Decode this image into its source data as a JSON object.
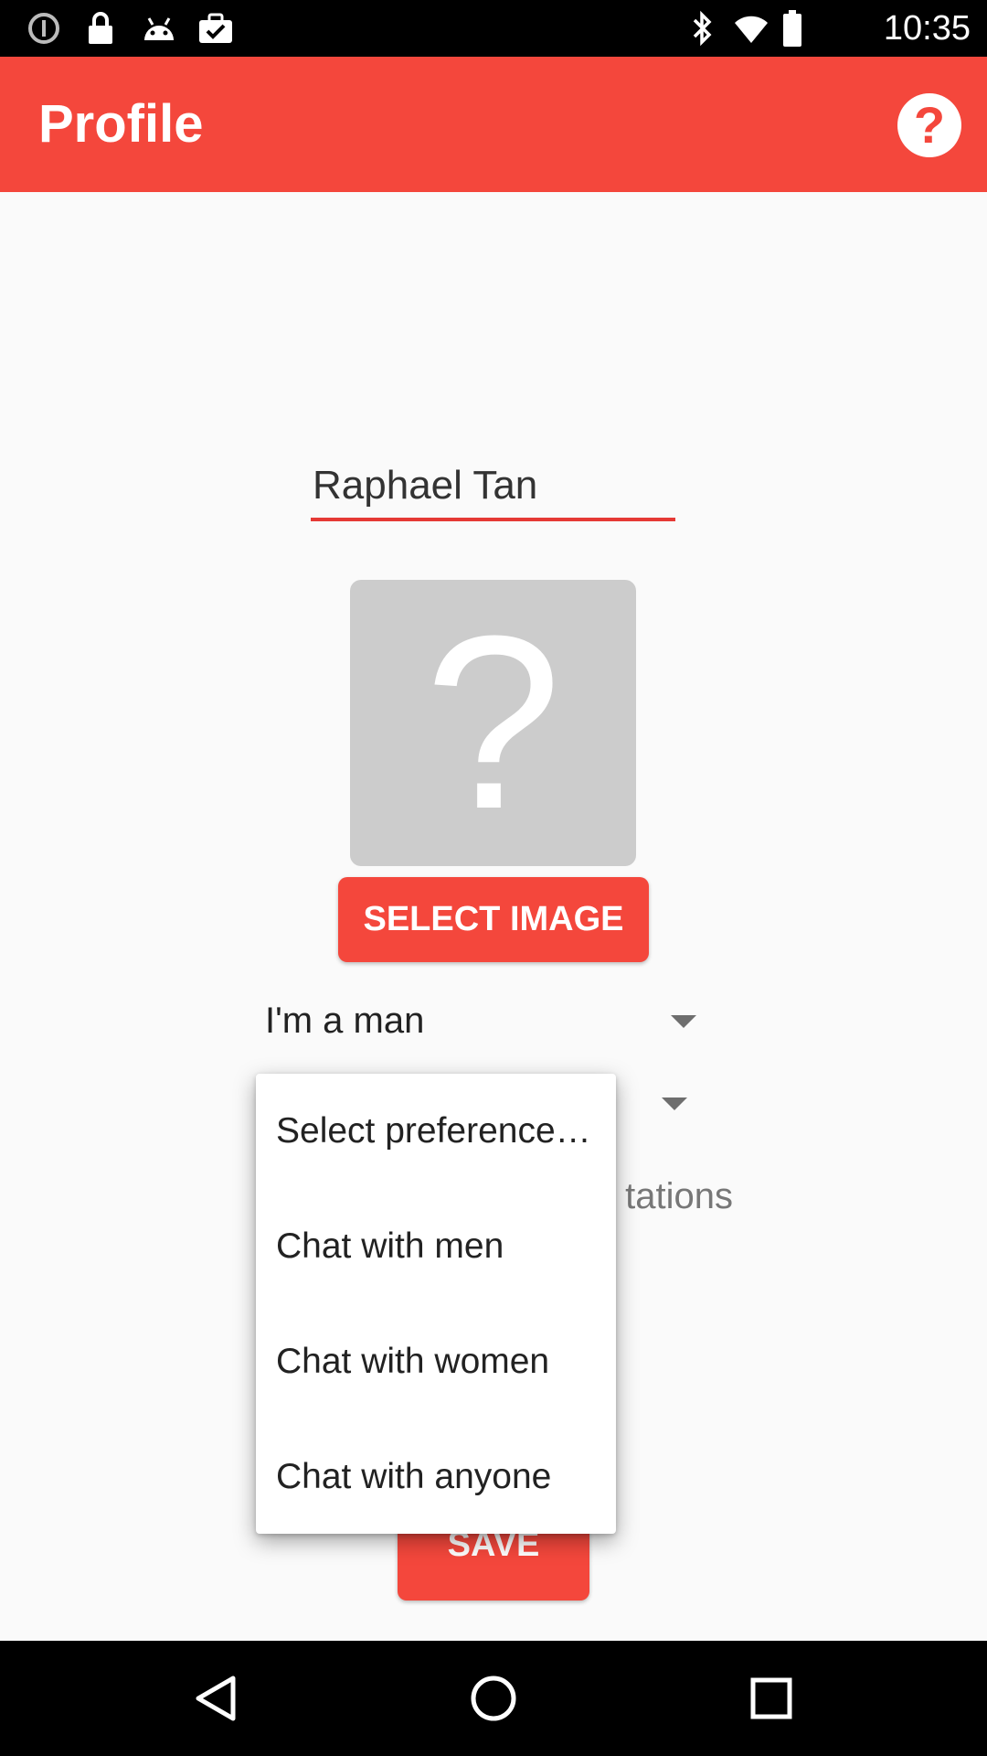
{
  "status_bar": {
    "time": "10:35",
    "left_icons": [
      "alert-icon",
      "lock-icon",
      "android-icon",
      "briefcase-check-icon"
    ],
    "right_icons": [
      "bluetooth-icon",
      "wifi-icon",
      "battery-icon"
    ]
  },
  "app_bar": {
    "title": "Profile",
    "help_icon": "help-circle-icon",
    "help_label": "?",
    "color": "#f4473c"
  },
  "profile": {
    "name_value": "Raphael Tan",
    "avatar_placeholder": "?",
    "select_image_label": "SELECT IMAGE",
    "gender_value": "I'm a man",
    "invitations_text": "tations",
    "save_label": "SAVE"
  },
  "dropdown": {
    "items": [
      {
        "label": "Select preference…"
      },
      {
        "label": "Chat with men"
      },
      {
        "label": "Chat with women"
      },
      {
        "label": "Chat with anyone"
      }
    ]
  },
  "nav_bar": {
    "icons": [
      "back-icon",
      "home-icon",
      "recents-icon"
    ]
  }
}
